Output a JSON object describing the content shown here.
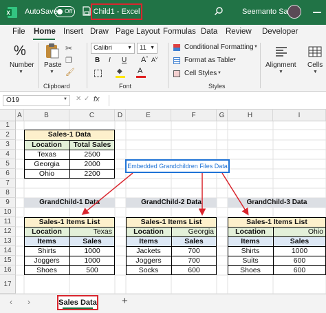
{
  "titlebar": {
    "autosave_label": "AutoSave",
    "autosave_state": "Off",
    "doc_title": "Child1  -  Excel",
    "user_name": "Seemanto Saha"
  },
  "menu": {
    "tabs": [
      "File",
      "Home",
      "Insert",
      "Draw",
      "Page Layout",
      "Formulas",
      "Data",
      "Review",
      "Developer"
    ],
    "active": "Home"
  },
  "ribbon": {
    "number_label": "Number",
    "paste_label": "Paste",
    "clipboard_label": "Clipboard",
    "font_name": "Calibri",
    "font_size": "11",
    "font_label": "Font",
    "bold": "B",
    "italic": "I",
    "underline": "U",
    "cond_format": "Conditional Formatting",
    "format_table": "Format as Table",
    "cell_styles": "Cell Styles",
    "styles_label": "Styles",
    "alignment_label": "Alignment",
    "cells_label": "Cells"
  },
  "formula_bar": {
    "name_box": "O19",
    "fx": "fx",
    "content": ""
  },
  "columns": [
    "A",
    "B",
    "C",
    "D",
    "E",
    "F",
    "G",
    "H",
    "I"
  ],
  "rows": [
    "1",
    "2",
    "3",
    "4",
    "5",
    "6",
    "7",
    "8",
    "9",
    "10",
    "11",
    "12",
    "13",
    "14",
    "15",
    "16",
    "17"
  ],
  "sales1": {
    "title": "Sales-1 Data",
    "headers": [
      "Location",
      "Total Sales"
    ],
    "rows": [
      [
        "Texas",
        "2500"
      ],
      [
        "Georgia",
        "2000"
      ],
      [
        "Ohio",
        "2200"
      ]
    ]
  },
  "callout": "Embedded Grandchildren Files Data",
  "grandchildren": [
    {
      "banner": "GrandChild-1 Data",
      "title": "Sales-1 Items List",
      "location_label": "Location",
      "location": "Texas",
      "headers": [
        "Items",
        "Sales"
      ],
      "rows": [
        [
          "Shirts",
          "1000"
        ],
        [
          "Joggers",
          "1000"
        ],
        [
          "Shoes",
          "500"
        ]
      ]
    },
    {
      "banner": "GrandChild-2 Data",
      "title": "Sales-1 Items List",
      "location_label": "Location",
      "location": "Georgia",
      "headers": [
        "Items",
        "Sales"
      ],
      "rows": [
        [
          "Jackets",
          "700"
        ],
        [
          "Joggers",
          "700"
        ],
        [
          "Socks",
          "600"
        ]
      ]
    },
    {
      "banner": "GrandChild-3 Data",
      "title": "Sales-1 Items List",
      "location_label": "Location",
      "location": "Ohio",
      "headers": [
        "Items",
        "Sales"
      ],
      "rows": [
        [
          "Shirts",
          "1000"
        ],
        [
          "Suits",
          "600"
        ],
        [
          "Shoes",
          "600"
        ]
      ]
    }
  ],
  "sheet_tabs": {
    "active": "Sales Data",
    "add": "+"
  },
  "colors": {
    "excel_green": "#217346",
    "highlight_red": "#d9262e",
    "callout_blue": "#1f73d6"
  }
}
